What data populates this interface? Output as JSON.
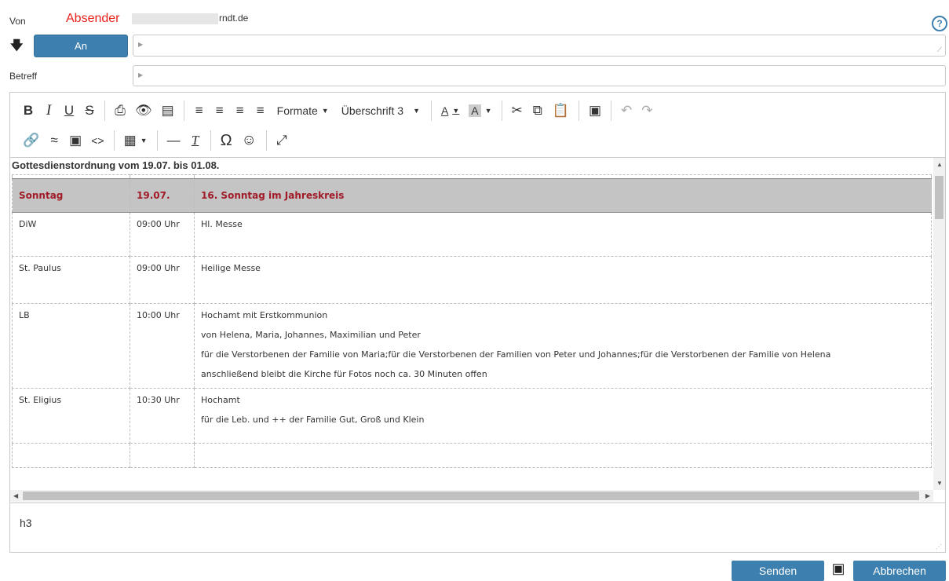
{
  "header": {
    "from_label": "Von",
    "sender_label": "Absender",
    "sender_suffix": "rndt.de",
    "to_button": "An",
    "subject_label": "Betreff"
  },
  "toolbar": {
    "formats_label": "Formate",
    "heading_label": "Überschrift 3"
  },
  "document": {
    "heading": "Gottesdienstordnung vom 19.07. bis 01.08.",
    "sunday_row": [
      "Sonntag",
      "19.07.",
      "16. Sonntag im Jahreskreis"
    ],
    "rows": [
      {
        "place": "DiW",
        "time": "09:00 Uhr",
        "lines": [
          "Hl. Messe"
        ]
      },
      {
        "place": "St. Paulus",
        "time": "09:00 Uhr",
        "lines": [
          "Heilige Messe"
        ]
      },
      {
        "place": "LB",
        "time": "10:00 Uhr",
        "lines": [
          "Hochamt mit Erstkommunion",
          "von Helena, Maria, Johannes, Maximilian und Peter",
          "für die Verstorbenen der Familie von Maria;für die Verstorbenen der Familien von Peter und Johannes;für die Verstorbenen der Familie von Helena",
          "anschließend bleibt die Kirche für Fotos noch ca. 30 Minuten offen"
        ]
      },
      {
        "place": "St. Eligius",
        "time": "10:30 Uhr",
        "lines": [
          "Hochamt",
          "für die Leb. und ++ der Familie Gut, Groß und Klein"
        ]
      }
    ]
  },
  "status": {
    "element_path": "h3"
  },
  "actions": {
    "send": "Senden",
    "cancel": "Abbrechen"
  },
  "colors": {
    "accent": "#3d7fae",
    "sender": "#e8221b",
    "sunday_text": "#a01b27",
    "sunday_bg": "#c4c4c4"
  }
}
